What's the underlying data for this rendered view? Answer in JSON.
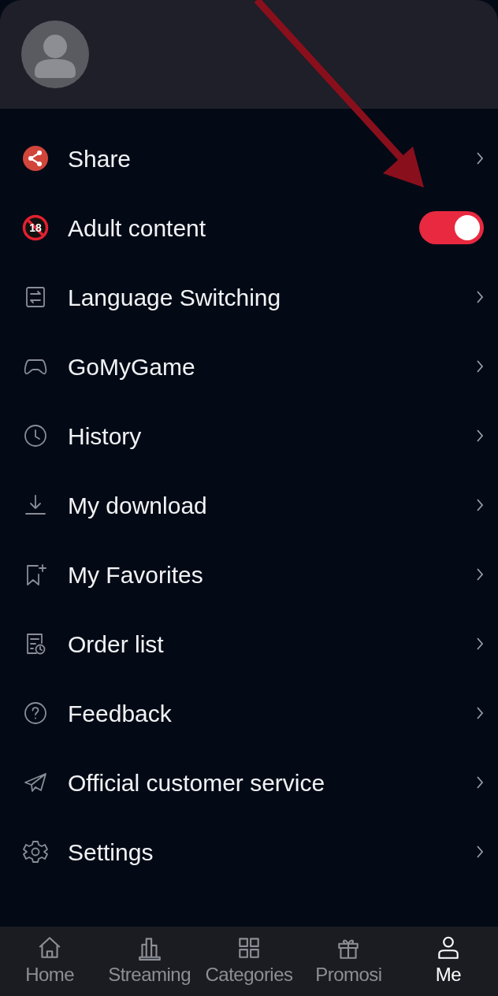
{
  "menu": [
    {
      "kind": "link",
      "label": "Share"
    },
    {
      "kind": "toggle",
      "label": "Adult content",
      "badge_text": "18",
      "on": true
    },
    {
      "kind": "link",
      "label": "Language Switching"
    },
    {
      "kind": "link",
      "label": "GoMyGame"
    },
    {
      "kind": "link",
      "label": "History"
    },
    {
      "kind": "link",
      "label": "My download"
    },
    {
      "kind": "link",
      "label": "My Favorites"
    },
    {
      "kind": "link",
      "label": "Order list"
    },
    {
      "kind": "link",
      "label": "Feedback"
    },
    {
      "kind": "link",
      "label": "Official customer service"
    },
    {
      "kind": "link",
      "label": "Settings"
    }
  ],
  "bottom_nav": [
    {
      "label": "Home",
      "selected": false
    },
    {
      "label": "Streaming",
      "selected": false
    },
    {
      "label": "Categories",
      "selected": false
    },
    {
      "label": "Promosi",
      "selected": false
    },
    {
      "label": "Me",
      "selected": true
    }
  ]
}
